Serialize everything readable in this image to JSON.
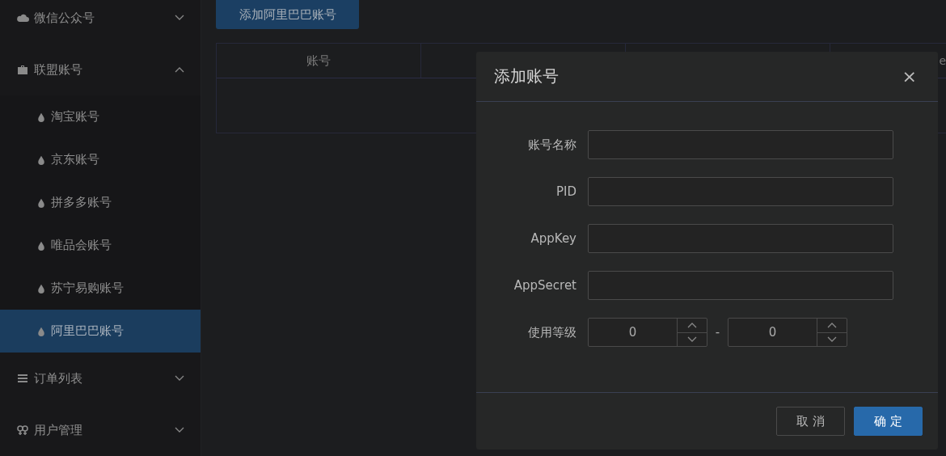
{
  "sidebar": {
    "items": [
      {
        "label": "微信公众号",
        "kind": "cloud",
        "expanded": false
      },
      {
        "label": "联盟账号",
        "kind": "briefcase",
        "expanded": true,
        "children": [
          {
            "label": "淘宝账号",
            "selected": false
          },
          {
            "label": "京东账号",
            "selected": false
          },
          {
            "label": "拼多多账号",
            "selected": false
          },
          {
            "label": "唯品会账号",
            "selected": false
          },
          {
            "label": "苏宁易购账号",
            "selected": false
          },
          {
            "label": "阿里巴巴账号",
            "selected": true
          }
        ]
      },
      {
        "label": "订单列表",
        "kind": "list",
        "expanded": false
      },
      {
        "label": "用户管理",
        "kind": "users",
        "expanded": false
      }
    ]
  },
  "toolbar": {
    "add_button": "添加阿里巴巴账号"
  },
  "table": {
    "columns": [
      "账号",
      "",
      "",
      "e"
    ]
  },
  "dialog": {
    "title": "添加账号",
    "close": "×",
    "fields": [
      {
        "kind": "text",
        "label": "账号名称"
      },
      {
        "kind": "text",
        "label": "PID"
      },
      {
        "kind": "text",
        "label": "AppKey"
      },
      {
        "kind": "text",
        "label": "AppSecret"
      },
      {
        "kind": "range",
        "label": "使用等级",
        "from": "0",
        "separator": "-",
        "to": "0"
      }
    ],
    "buttons": [
      {
        "label": "取 消",
        "kind": "default"
      },
      {
        "label": "确 定",
        "kind": "primary"
      }
    ]
  }
}
